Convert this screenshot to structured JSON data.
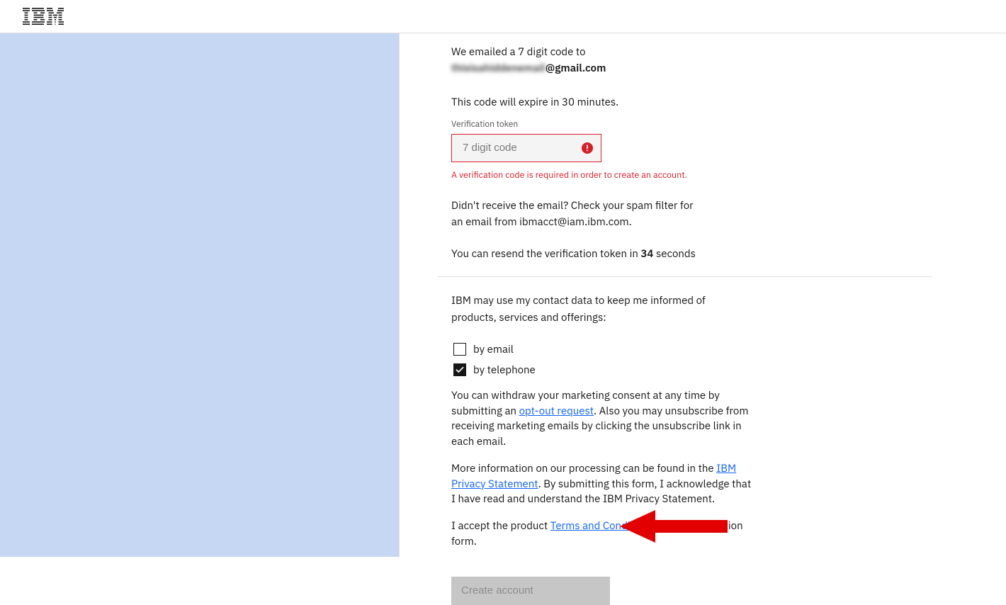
{
  "header": {
    "logo_alt": "IBM"
  },
  "verify": {
    "sent_prefix": "We emailed a 7 digit code to",
    "email_localpart_blurred": "thisisahiddenemail",
    "email_domain": "@gmail.com",
    "expire_text": "This code will expire in 30 minutes.",
    "field_label": "Verification token",
    "placeholder": "7 digit code",
    "error_msg": "A verification code is required in order to create an account.",
    "spam_text": "Didn't receive the email? Check your spam filter for an email from ibmacct@iam.ibm.com.",
    "resend_prefix": "You can resend the verification token in ",
    "resend_seconds": "34",
    "resend_suffix": " seconds"
  },
  "consent": {
    "intro": "IBM may use my contact data to keep me informed of products, services and offerings:",
    "options": {
      "email": {
        "label": "by email",
        "checked": false
      },
      "telephone": {
        "label": "by telephone",
        "checked": true
      }
    },
    "para1_a": "You can withdraw your marketing consent at any time by submitting an ",
    "optout_link": "opt-out request",
    "para1_b": ". Also you may unsubscribe from receiving marketing emails by clicking the unsubscribe link in each email.",
    "para2_a": "More information on our processing can be found in the ",
    "privacy_link": "IBM Privacy Statement",
    "para2_b": ". By submitting this form, I acknowledge that I have read and understand the IBM Privacy Statement.",
    "para3_a": "I accept the product ",
    "terms_link": "Terms and Conditions",
    "para3_b": " of this registration form."
  },
  "buttons": {
    "create_account": "Create account"
  }
}
